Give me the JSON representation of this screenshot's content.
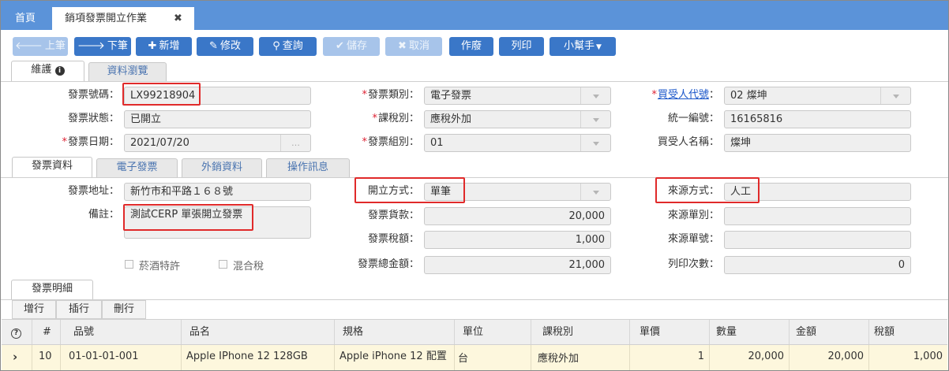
{
  "tabs": {
    "home": "首頁",
    "active": "銷項發票開立作業",
    "close": "✖"
  },
  "toolbar": {
    "prev": "上筆",
    "next": "下筆",
    "add": "新增",
    "edit": "修改",
    "query": "查詢",
    "save": "儲存",
    "cancel": "取消",
    "void": "作廢",
    "print": "列印",
    "helper": "小幫手"
  },
  "icons": {
    "prev": "arrow-left-icon",
    "next": "arrow-right-icon",
    "add": "plus-icon",
    "edit": "pencil-icon",
    "query": "search-icon",
    "save": "check-icon",
    "cancel": "x-icon",
    "helper": "caret-down-icon",
    "info": "info-icon",
    "help": "question-icon",
    "rowArrow": "chevron-right-icon"
  },
  "subtabs": {
    "maintain": "維護",
    "browse": "資料瀏覽"
  },
  "form": {
    "invoiceNo": {
      "label": "發票號碼：",
      "value": "LX99218904"
    },
    "invoiceStatus": {
      "label": "發票狀態：",
      "value": "已開立"
    },
    "invoiceDate": {
      "label": "發票日期：",
      "value": "2021/07/20"
    },
    "invoiceCategory": {
      "label": "發票類別：",
      "value": "電子發票"
    },
    "taxType": {
      "label": "課稅別：",
      "value": "應稅外加"
    },
    "invoiceGroup": {
      "label": "發票組別：",
      "value": "01"
    },
    "buyerCode": {
      "label": "買受人代號",
      "colon": "：",
      "value": "02 燦坤"
    },
    "taxId": {
      "label": "統一編號：",
      "value": "16165816"
    },
    "buyerName": {
      "label": "買受人名稱：",
      "value": "燦坤"
    }
  },
  "detailTabs": {
    "info": "發票資料",
    "einvoice": "電子發票",
    "export": "外銷資料",
    "oplog": "操作訊息"
  },
  "detail": {
    "address": {
      "label": "發票地址：",
      "value": "新竹市和平路１６８號"
    },
    "note": {
      "label": "備註：",
      "value": "測試CERP 單張開立發票"
    },
    "issueMethod": {
      "label": "開立方式：",
      "value": "單筆"
    },
    "amount": {
      "label": "發票貨款：",
      "value": "20,000"
    },
    "tax": {
      "label": "發票稅額：",
      "value": "1,000"
    },
    "total": {
      "label": "發票總金額：",
      "value": "21,000"
    },
    "sourceMethod": {
      "label": "來源方式：",
      "value": "人工"
    },
    "sourceType": {
      "label": "來源單別：",
      "value": ""
    },
    "sourceNo": {
      "label": "來源單號：",
      "value": ""
    },
    "printCount": {
      "label": "列印次數：",
      "value": "0"
    },
    "tobacco": "菸酒特許",
    "mixedTax": "混合稅"
  },
  "grid": {
    "tab": "發票明細",
    "buttons": {
      "add": "增行",
      "insert": "插行",
      "delete": "刪行"
    },
    "headers": [
      "#",
      "品號",
      "品名",
      "規格",
      "單位",
      "課稅別",
      "單價",
      "數量",
      "金額",
      "稅額"
    ],
    "row": {
      "no": "10",
      "itemNo": "01-01-01-001",
      "name": "Apple IPhone 12 128GB",
      "spec": "Apple iPhone 12 配置",
      "unit": "台",
      "taxType": "應稅外加",
      "price": "1",
      "qty": "20,000",
      "amount": "20,000",
      "tax": "1,000"
    }
  },
  "colors": {
    "accent": "#3a77c8",
    "topbar": "#5b93d9",
    "highlight": "#e02a2a",
    "selectedRow": "#fdf7dd"
  }
}
